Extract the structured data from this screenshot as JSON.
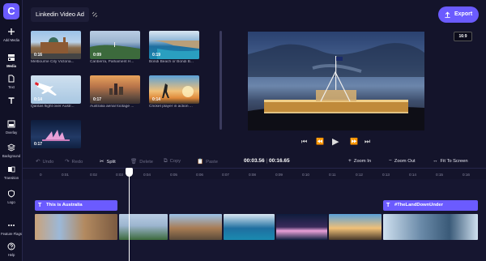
{
  "project": {
    "title": "Linkedin Video Ad"
  },
  "export": {
    "label": "Export"
  },
  "aspect_ratio": "16:9",
  "sidebar": {
    "items": [
      {
        "label": "Add Media",
        "icon": "plus-icon"
      },
      {
        "label": "Media",
        "icon": "media-icon"
      },
      {
        "label": "Text",
        "icon": "text-icon"
      },
      {
        "label": "Overlay",
        "icon": "overlay-icon"
      },
      {
        "label": "Background",
        "icon": "background-icon"
      },
      {
        "label": "Transition",
        "icon": "transition-icon"
      },
      {
        "label": "Logo",
        "icon": "shield-icon"
      },
      {
        "label": "Feature Flags",
        "icon": "more-icon"
      },
      {
        "label": "Help",
        "icon": "help-icon"
      }
    ]
  },
  "media": {
    "items": [
      {
        "label": "Melbourne City Victoria...",
        "duration": "0:16"
      },
      {
        "label": "Canberra, Parliament H...",
        "duration": "0:09"
      },
      {
        "label": "Bondi Beach or Bondi B...",
        "duration": "0:19"
      },
      {
        "label": "Qantas flight over Austr...",
        "duration": "0:14"
      },
      {
        "label": "Australia aerial footage ...",
        "duration": "0:17"
      },
      {
        "label": "Cricket player in action ...",
        "duration": "0:14"
      },
      {
        "label": "",
        "duration": "0:17"
      }
    ]
  },
  "toolbar": {
    "undo": "Undo",
    "redo": "Redo",
    "split": "Split",
    "delete": "Delete",
    "copy": "Copy",
    "paste": "Paste",
    "time_current": "00:03.56",
    "time_sep": "|",
    "time_total": "00:16.65",
    "zoom_in": "Zoom In",
    "zoom_out": "Zoom Out",
    "fit": "Fit To Screen"
  },
  "ruler": {
    "ticks": [
      "0",
      "0:01",
      "0:02",
      "0:03",
      "0:04",
      "0:05",
      "0:06",
      "0:07",
      "0:08",
      "0:09",
      "0:10",
      "0:11",
      "0:12",
      "0:13",
      "0:14",
      "0:15",
      "0:16"
    ]
  },
  "timeline": {
    "text_clips": [
      {
        "label": "This is Australia"
      },
      {
        "label": "#TheLandDownUnder"
      }
    ]
  },
  "colors": {
    "accent": "#6b5bff",
    "background": "#14142b"
  }
}
